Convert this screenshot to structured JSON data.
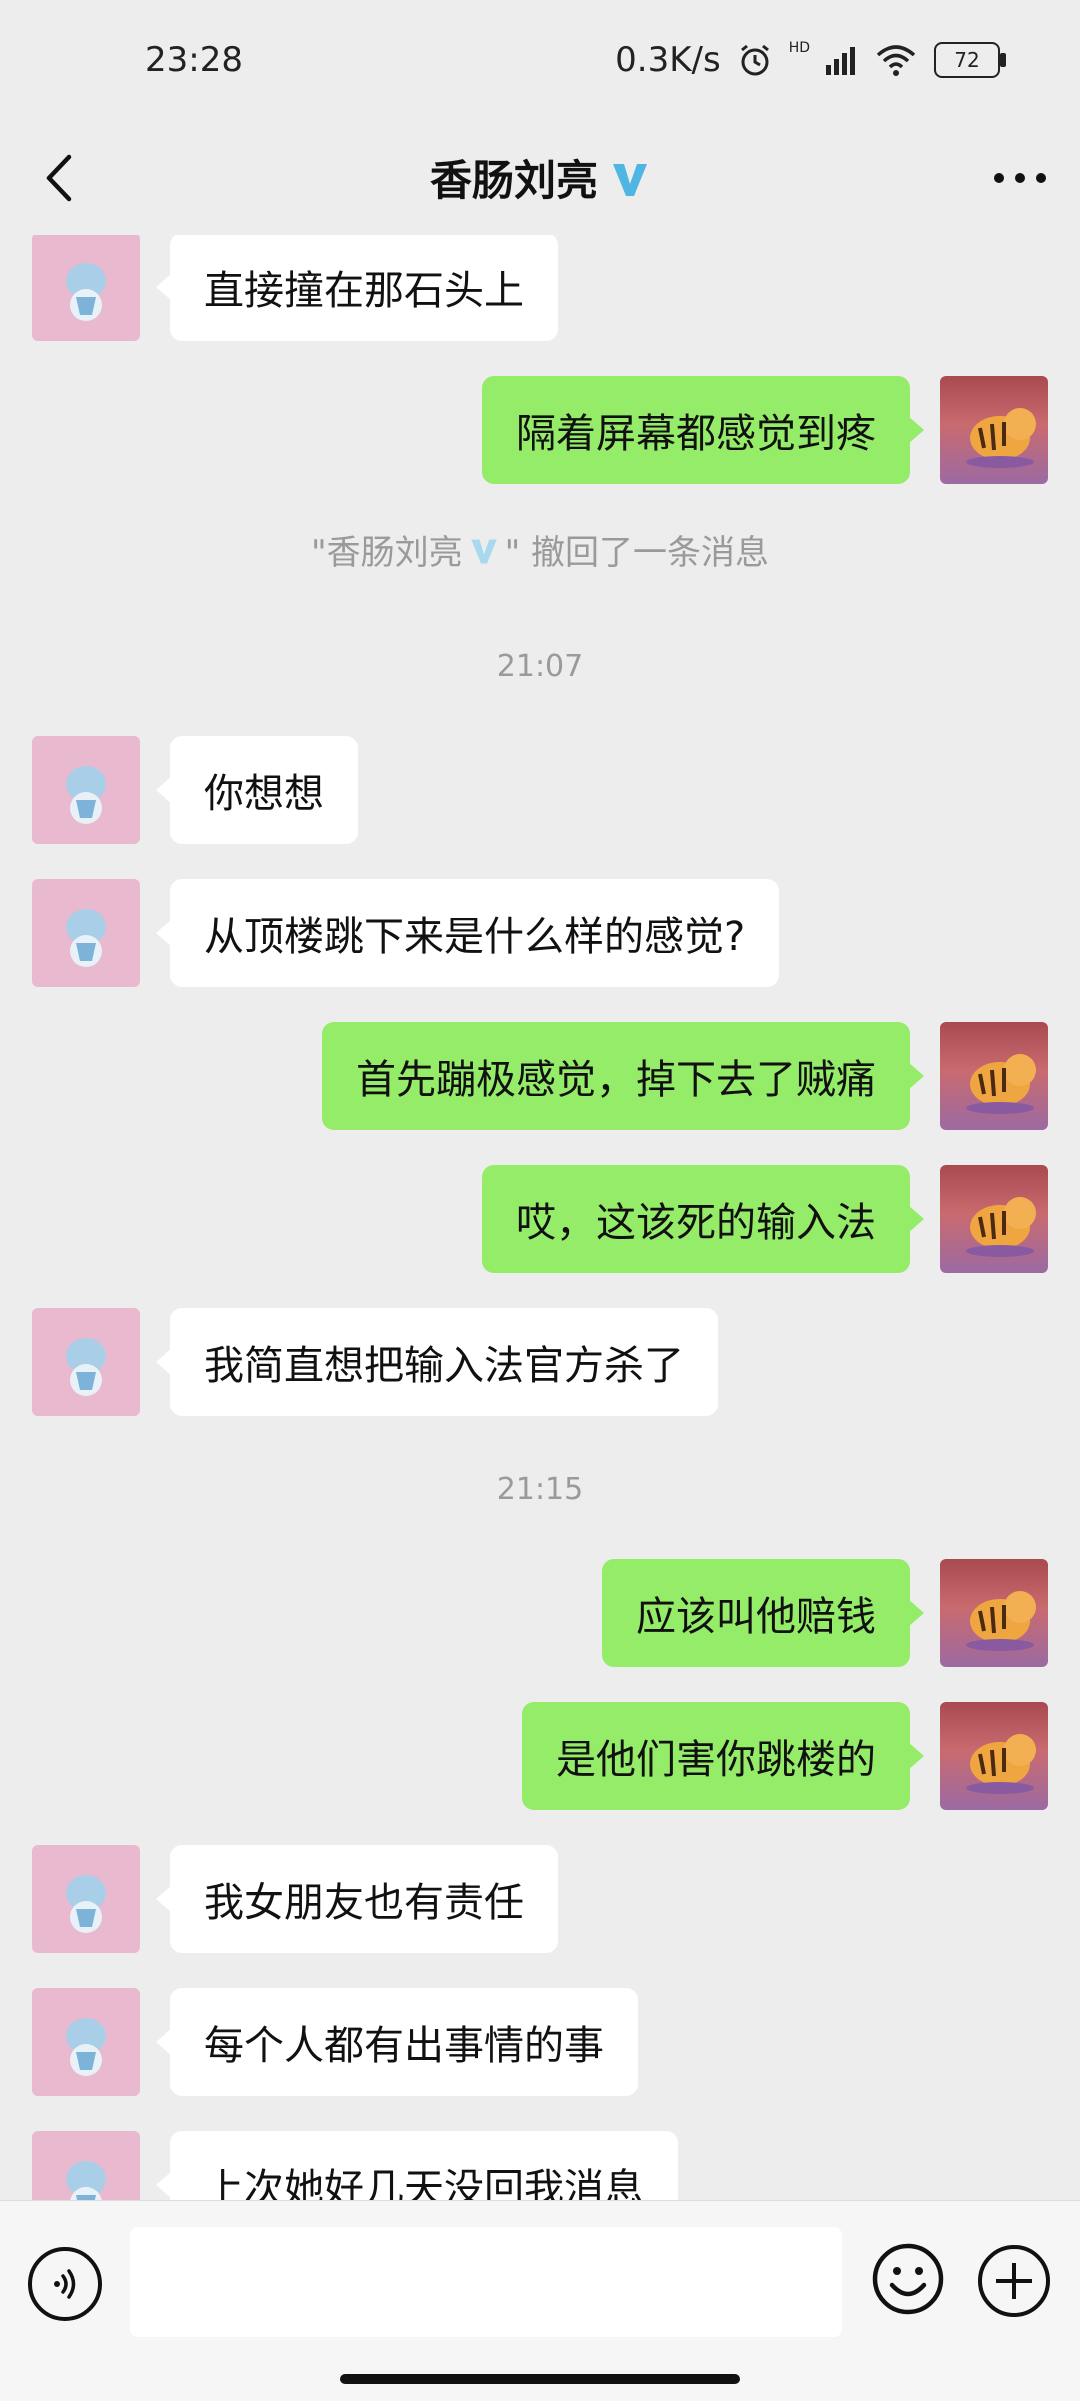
{
  "status_bar": {
    "time": "23:28",
    "net_speed": "0.3K/s",
    "hd": "HD",
    "battery": "72"
  },
  "header": {
    "title": "香肠刘亮",
    "back_icon": "chevron-left-icon",
    "more_icon": "more-icon"
  },
  "chat": {
    "system_message": {
      "prefix": "\"香肠刘亮",
      "suffix": "\" 撤回了一条消息"
    },
    "timestamps": [
      "21:07",
      "21:15"
    ],
    "messages": [
      {
        "side": "left",
        "text": "直接撞在那石头上"
      },
      {
        "side": "right",
        "text": "隔着屏幕都感觉到疼"
      },
      {
        "side": "left",
        "text": "你想想"
      },
      {
        "side": "left",
        "text": "从顶楼跳下来是什么样的感觉?"
      },
      {
        "side": "right",
        "text": "首先蹦极感觉，掉下去了贼痛"
      },
      {
        "side": "right",
        "text": "哎，这该死的输入法"
      },
      {
        "side": "left",
        "text": "我简直想把输入法官方杀了"
      },
      {
        "side": "right",
        "text": "应该叫他赔钱"
      },
      {
        "side": "right",
        "text": "是他们害你跳楼的"
      },
      {
        "side": "left",
        "text": "我女朋友也有责任"
      },
      {
        "side": "left",
        "text": "每个人都有出事情的事"
      },
      {
        "side": "left",
        "text": "上次她好几天没回我消息"
      }
    ]
  },
  "input_bar": {
    "voice_icon": "voice-icon",
    "message_placeholder": "",
    "emoji_icon": "emoji-icon",
    "plus_icon": "plus-icon"
  },
  "colors": {
    "background": "#ededed",
    "sent_bubble": "#95ec69",
    "received_bubble": "#ffffff",
    "verified_badge": "#4fb6e3"
  }
}
